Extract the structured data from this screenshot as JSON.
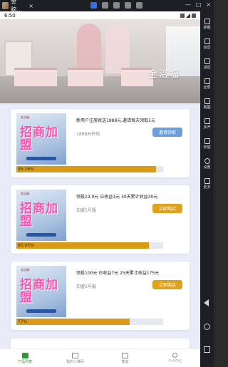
{
  "emulator": {
    "tab_title": "金脑...",
    "close": "×",
    "window_buttons": [
      "—",
      "□",
      "×"
    ]
  },
  "status_bar": {
    "time": "6:50"
  },
  "banner": {
    "logo_text": "金涪福"
  },
  "products": [
    {
      "title": "新用户注册就送1888元,邀请每天领取1元",
      "tag": "1888元补贴",
      "button": "邀请领取",
      "button_style": "blue",
      "progress_label": "95.36%",
      "progress": 0.9536,
      "thumb_brand": "金涪福",
      "thumb_text": "招商加盟"
    },
    {
      "title": "领投19.9元 日收益1元 30天累计收益30元",
      "tag": "加盟1号服",
      "button": "立即购买",
      "button_style": "orange",
      "progress_label": "90.45%",
      "progress": 0.9045,
      "thumb_brand": "金涪福",
      "thumb_text": "招商加盟"
    },
    {
      "title": "领投100元 日收益7元 25天累计收益175元",
      "tag": "加盟2号服",
      "button": "立即购买",
      "button_style": "orange",
      "progress_label": "77%",
      "progress": 0.77,
      "thumb_brand": "金涪福",
      "thumb_text": "招商加盟"
    }
  ],
  "tabbar": {
    "items": [
      {
        "label": "产品列表",
        "icon": "cart-icon",
        "active": true
      },
      {
        "label": "我的二维码",
        "icon": "qrcode-icon",
        "active": false
      },
      {
        "label": "教室",
        "icon": "document-icon",
        "active": false
      },
      {
        "label": "个人中心",
        "icon": "person-icon",
        "active": false
      }
    ]
  },
  "emulator_sidebar": {
    "items": [
      {
        "label": "按键",
        "icon": "keyboard-icon"
      },
      {
        "label": "加音",
        "icon": "volume-up-icon"
      },
      {
        "label": "减音",
        "icon": "volume-down-icon"
      },
      {
        "label": "全屏",
        "icon": "fullscreen-icon"
      },
      {
        "label": "截图",
        "icon": "screenshot-icon"
      },
      {
        "label": "多开",
        "icon": "multi-instance-icon"
      },
      {
        "label": "安装",
        "icon": "install-icon"
      },
      {
        "label": "设置",
        "icon": "gear-icon"
      },
      {
        "label": "更多",
        "icon": "more-icon"
      }
    ]
  },
  "colors": {
    "accent_green": "#2c9b3a",
    "progress_fill": "#d99a16",
    "button_blue": "#6c9fd9",
    "button_orange": "#e1a21b",
    "content_bg": "#e9ecf8"
  }
}
